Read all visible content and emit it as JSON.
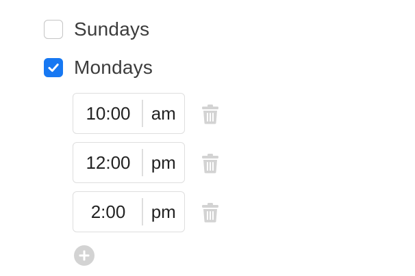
{
  "days": [
    {
      "label": "Sundays",
      "checked": false
    },
    {
      "label": "Mondays",
      "checked": true
    }
  ],
  "times": [
    {
      "value": "10:00",
      "period": "am"
    },
    {
      "value": "12:00",
      "period": "pm"
    },
    {
      "value": "2:00",
      "period": "pm"
    }
  ],
  "icons": {
    "checkbox_unchecked": "checkbox-empty-icon",
    "checkbox_checked": "checkmark-icon",
    "delete": "trash-icon",
    "add": "plus-circle-icon"
  },
  "colors": {
    "accent": "#1778f2",
    "icon_gray": "#d3d3d3",
    "border": "#dedede"
  }
}
